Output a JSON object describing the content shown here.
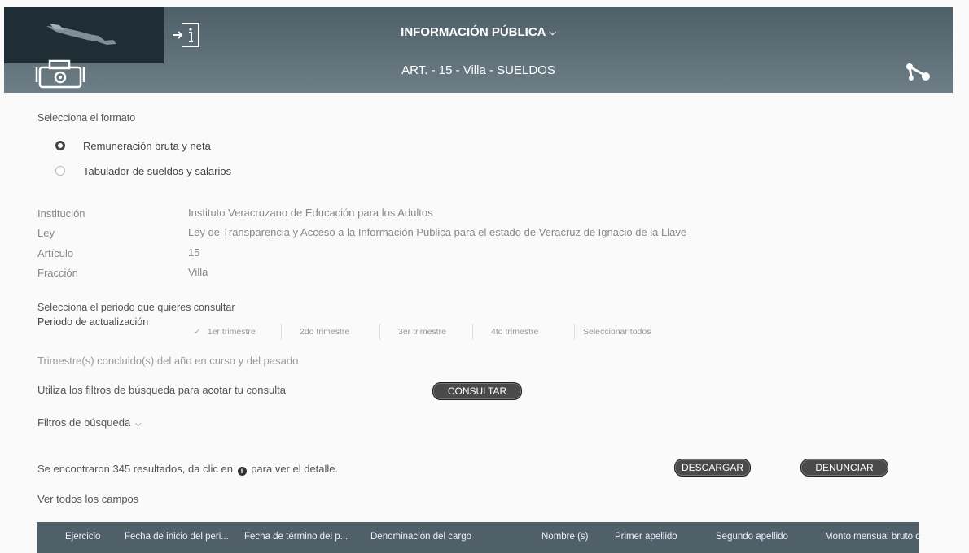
{
  "header": {
    "title": "INFORMACIÓN PÚBLICA",
    "subtitle": "ART. - 15 - Villa - SUELDOS"
  },
  "format": {
    "prompt": "Selecciona el formato",
    "options": [
      {
        "label": "Remuneración bruta y neta",
        "selected": true
      },
      {
        "label": "Tabulador de sueldos y salarios",
        "selected": false
      }
    ]
  },
  "info": [
    {
      "label": "Institución",
      "value": "Instituto Veracruzano de Educación para los Adultos"
    },
    {
      "label": "Ley",
      "value": "Ley de Transparencia y Acceso a la Información Pública para el estado de Veracruz de Ignacio de la Llave"
    },
    {
      "label": "Artículo",
      "value": "15"
    },
    {
      "label": "Fracción",
      "value": "Villa"
    }
  ],
  "period": {
    "prompt": "Selecciona el periodo que quieres consultar",
    "label": "Periodo de actualización",
    "options": [
      "1er trimestre",
      "2do trimestre",
      "3er trimestre",
      "4to trimestre",
      "Seleccionar todos"
    ],
    "checkmark": "✓",
    "note": "Trimestre(s) concluido(s) del año en curso y del pasado"
  },
  "filters": {
    "hint": "Utiliza los filtros de búsqueda para acotar tu consulta",
    "consult_label": "CONSULTAR",
    "toggle_label": "Filtros de búsqueda"
  },
  "results": {
    "text_before": "Se encontraron 345 resultados, da clic en",
    "text_after": "para ver el detalle.",
    "download_label": "DESCARGAR",
    "report_label": "DENUNCIAR",
    "show_all": "Ver todos los campos"
  },
  "table": {
    "columns": [
      "Ejercicio",
      "Fecha de inicio del peri...",
      "Fecha de término del p...",
      "Denominación del cargo",
      "Nombre (s)",
      "Primer apellido",
      "Segundo apellido",
      "Monto mensual bruto d..."
    ]
  }
}
